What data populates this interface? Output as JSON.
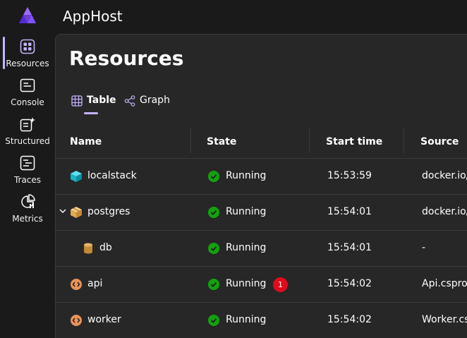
{
  "app": {
    "title": "AppHost",
    "accent": "#c5b3ff"
  },
  "sidebar": {
    "items": [
      {
        "label": "Resources",
        "icon": "resources-icon",
        "active": true
      },
      {
        "label": "Console",
        "icon": "console-icon"
      },
      {
        "label": "Structured",
        "icon": "structured-icon"
      },
      {
        "label": "Traces",
        "icon": "traces-icon"
      },
      {
        "label": "Metrics",
        "icon": "metrics-icon"
      }
    ]
  },
  "main": {
    "title": "Resources",
    "tabs": [
      {
        "label": "Table",
        "icon": "table-icon",
        "selected": true
      },
      {
        "label": "Graph",
        "icon": "graph-icon"
      }
    ]
  },
  "grid": {
    "columns": [
      "Name",
      "State",
      "Start time",
      "Source"
    ],
    "rows": [
      {
        "name": "localstack",
        "icon": "container-icon",
        "state": "Running",
        "start": "15:53:59",
        "source": "docker.io/",
        "badge": ""
      },
      {
        "name": "postgres",
        "icon": "package-icon",
        "state": "Running",
        "start": "15:54:01",
        "source": "docker.io/",
        "badge": "",
        "expanded": true
      },
      {
        "name": "db",
        "icon": "database-icon",
        "state": "Running",
        "start": "15:54:01",
        "source": "-",
        "badge": ""
      },
      {
        "name": "api",
        "icon": "project-icon",
        "state": "Running",
        "start": "15:54:02",
        "source": "Api.csproj",
        "badge": "1"
      },
      {
        "name": "worker",
        "icon": "project-icon",
        "state": "Running",
        "start": "15:54:02",
        "source": "Worker.cs",
        "badge": ""
      }
    ]
  }
}
